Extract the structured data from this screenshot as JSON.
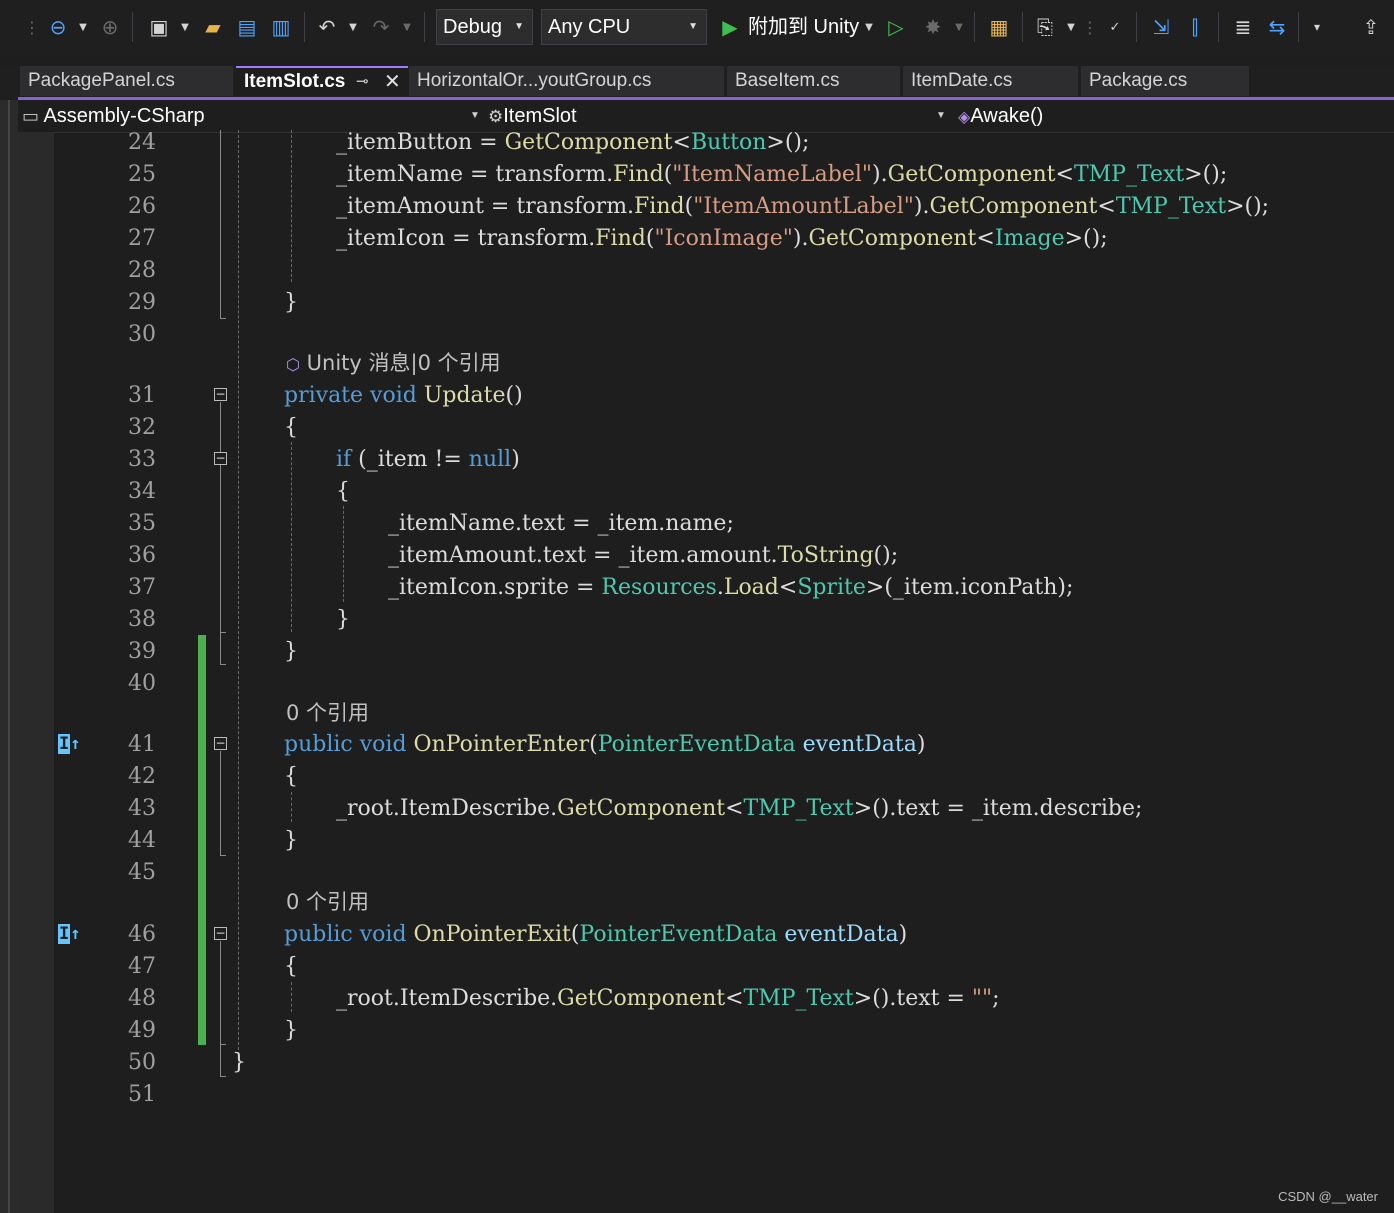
{
  "toolbar": {
    "config": "Debug",
    "platform": "Any CPU",
    "run_label": "附加到 Unity"
  },
  "tabs": [
    {
      "label": "PackagePanel.cs",
      "active": false
    },
    {
      "label": "ItemSlot.cs",
      "active": true
    },
    {
      "label": "HorizontalOr...youtGroup.cs",
      "active": false
    },
    {
      "label": "BaseItem.cs",
      "active": false
    },
    {
      "label": "ItemDate.cs",
      "active": false
    },
    {
      "label": "Package.cs",
      "active": false
    }
  ],
  "nav": {
    "project": "Assembly-CSharp",
    "class": "ItemSlot",
    "member": "Awake()"
  },
  "code": {
    "line_numbers": [
      "24",
      "25",
      "26",
      "27",
      "28",
      "29",
      "30",
      "31",
      "32",
      "33",
      "34",
      "35",
      "36",
      "37",
      "38",
      "39",
      "40",
      "41",
      "42",
      "43",
      "44",
      "45",
      "46",
      "47",
      "48",
      "49",
      "50",
      "51"
    ],
    "codelens": {
      "unity": "Unity 消息|0 个引用",
      "enter_refs": "0 个引用",
      "exit_refs": "0 个引用"
    }
  },
  "watermark": "CSDN @__water",
  "colors": {
    "accent": "#8a63d2",
    "change_bar": "#4caf50",
    "keyword": "#569cd6",
    "type": "#4ec9b0",
    "method": "#dcdcaa",
    "string": "#d69d85"
  }
}
